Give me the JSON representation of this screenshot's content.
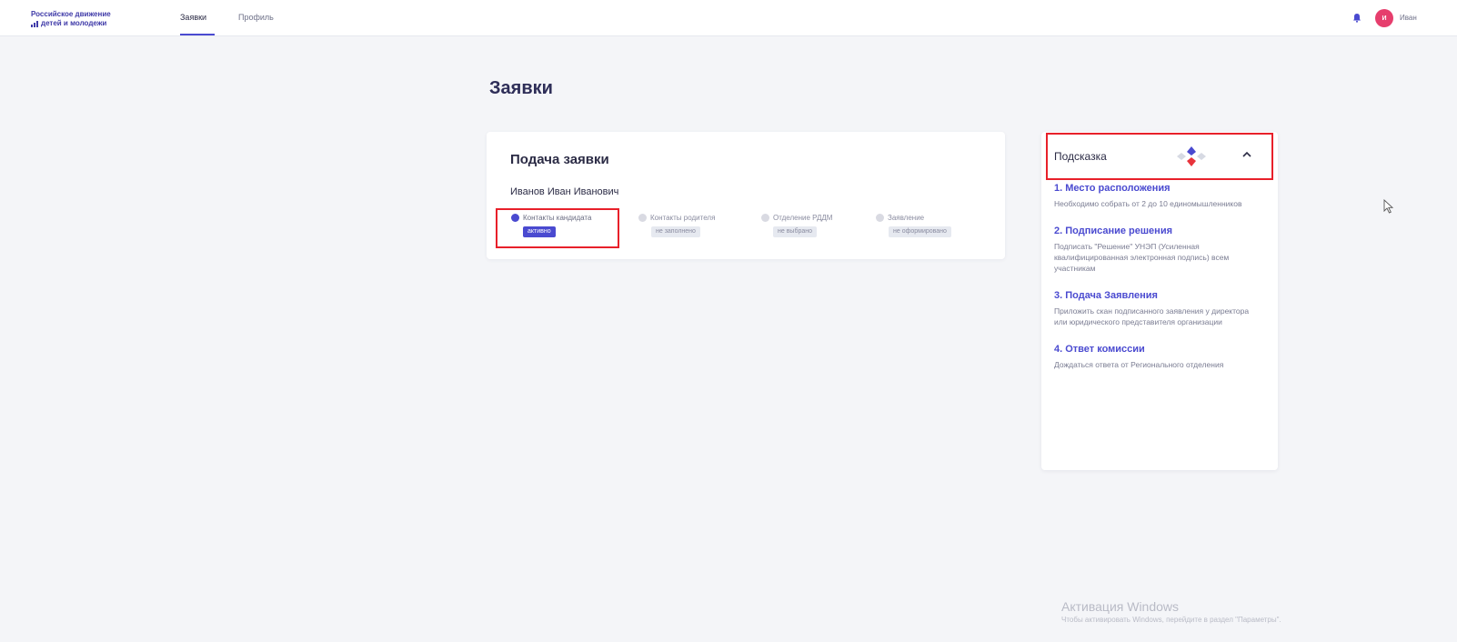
{
  "header": {
    "logo_line1": "Российское движение",
    "logo_line2": "детей и молодежи",
    "nav": [
      {
        "label": "Заявки",
        "active": true
      },
      {
        "label": "Профиль",
        "active": false
      }
    ],
    "avatar_initial": "И",
    "user_name": "Иван",
    "accent_color": "#4a4ad0",
    "avatar_color": "#e63e6d"
  },
  "main": {
    "page_title": "Заявки",
    "card": {
      "title": "Подача заявки",
      "person": "Иванов Иван Иванович",
      "steps": [
        {
          "label": "Контакты кандидата",
          "status": "активно",
          "current": true
        },
        {
          "label": "Контакты родителя",
          "status": "не заполнено",
          "current": false
        },
        {
          "label": "Отделение РДДМ",
          "status": "не выбрано",
          "current": false
        },
        {
          "label": "Заявление",
          "status": "не оформировано",
          "current": false
        }
      ]
    }
  },
  "hint": {
    "title": "Подсказка",
    "chevron_icon": "chevron-up-icon",
    "steps": [
      {
        "title": "1. Место расположения",
        "text": "Необходимо собрать от 2 до 10 единомышленников"
      },
      {
        "title": "2. Подписание решения",
        "text": "Подписать \"Решение\" УНЭП (Усиленная квалифицированная электронная подпись) всем участникам"
      },
      {
        "title": "3. Подача Заявления",
        "text": "Приложить скан подписанного заявления у директора или юридического представителя организации"
      },
      {
        "title": "4. Ответ комиссии",
        "text": "Дождаться ответа от Регионального отделения"
      }
    ]
  },
  "watermark": {
    "line1": "Активация Windows",
    "line2": "Чтобы активировать Windows, перейдите в раздел \"Параметры\"."
  },
  "highlight_color": "#e8202a"
}
